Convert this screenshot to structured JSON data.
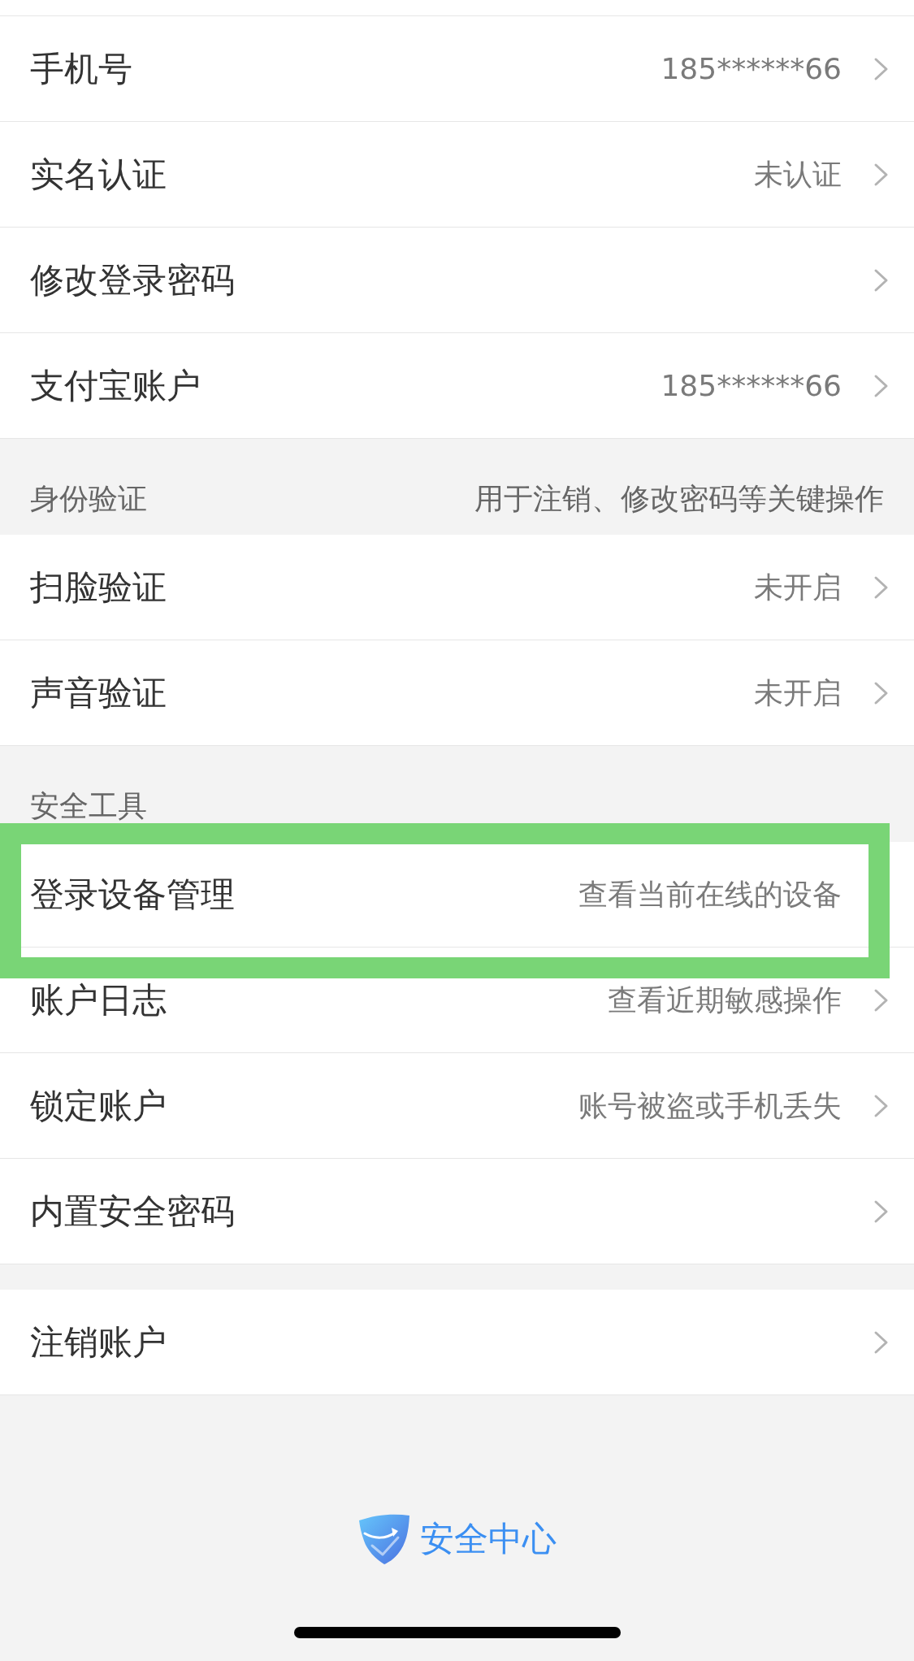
{
  "sections": [
    {
      "rows": [
        {
          "title": "手机号",
          "value": "185******66",
          "chevron": true,
          "highlighted": false
        },
        {
          "title": "实名认证",
          "value": "未认证",
          "chevron": true,
          "highlighted": false
        },
        {
          "title": "修改登录密码",
          "chevron": true,
          "highlighted": false
        },
        {
          "title": "支付宝账户",
          "value": "185******66",
          "chevron": true,
          "highlighted": false
        }
      ]
    },
    {
      "header": {
        "title": "身份验证",
        "note": "用于注销、修改密码等关键操作"
      },
      "rows": [
        {
          "title": "扫脸验证",
          "value": "未开启",
          "chevron": true,
          "highlighted": false
        },
        {
          "title": "声音验证",
          "value": "未开启",
          "chevron": true,
          "highlighted": false
        }
      ]
    },
    {
      "header": {
        "title": "安全工具"
      },
      "rows": [
        {
          "title": "登录设备管理",
          "value": "查看当前在线的设备",
          "chevron": false,
          "highlighted": true
        },
        {
          "title": "账户日志",
          "value": "查看近期敏感操作",
          "chevron": true,
          "highlighted": false
        },
        {
          "title": "锁定账户",
          "value": "账号被盗或手机丢失",
          "chevron": true,
          "highlighted": false
        },
        {
          "title": "内置安全密码",
          "chevron": true,
          "highlighted": false
        }
      ]
    },
    {
      "rows": [
        {
          "title": "注销账户",
          "chevron": true,
          "highlighted": false
        }
      ]
    }
  ],
  "footer": {
    "brand": "安全中心"
  }
}
